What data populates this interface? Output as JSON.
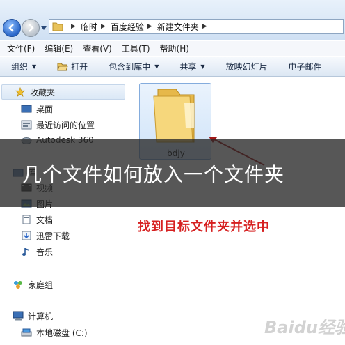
{
  "address": {
    "crumbs": [
      "临时",
      "百度经验",
      "新建文件夹"
    ]
  },
  "menu": [
    "文件(F)",
    "编辑(E)",
    "查看(V)",
    "工具(T)",
    "帮助(H)"
  ],
  "commands": [
    {
      "label": "组织",
      "dropdown": true
    },
    {
      "label": "打开",
      "dropdown": false
    },
    {
      "label": "包含到库中",
      "dropdown": true
    },
    {
      "label": "共享",
      "dropdown": true
    },
    {
      "label": "放映幻灯片",
      "dropdown": false
    },
    {
      "label": "电子邮件",
      "dropdown": false
    }
  ],
  "nav": {
    "favorites": "收藏夹",
    "desktop": "桌面",
    "recent": "最近访问的位置",
    "autodesk": "Autodesk 360",
    "libraries": "库",
    "video": "视频",
    "pictures": "图片",
    "documents": "文档",
    "xunlei": "迅雷下载",
    "music": "音乐",
    "homegroup": "家庭组",
    "computer": "计算机",
    "local_disk": "本地磁盘 (C:)"
  },
  "folder": {
    "name": "bdjy"
  },
  "annotation": "找到目标文件夹并选中",
  "banner": "几个文件如何放入一个文件夹",
  "watermark": "Baidu经验",
  "colors": {
    "annotation": "#d62020",
    "arrow": "#a01818",
    "folder": "#f3cf6a"
  }
}
